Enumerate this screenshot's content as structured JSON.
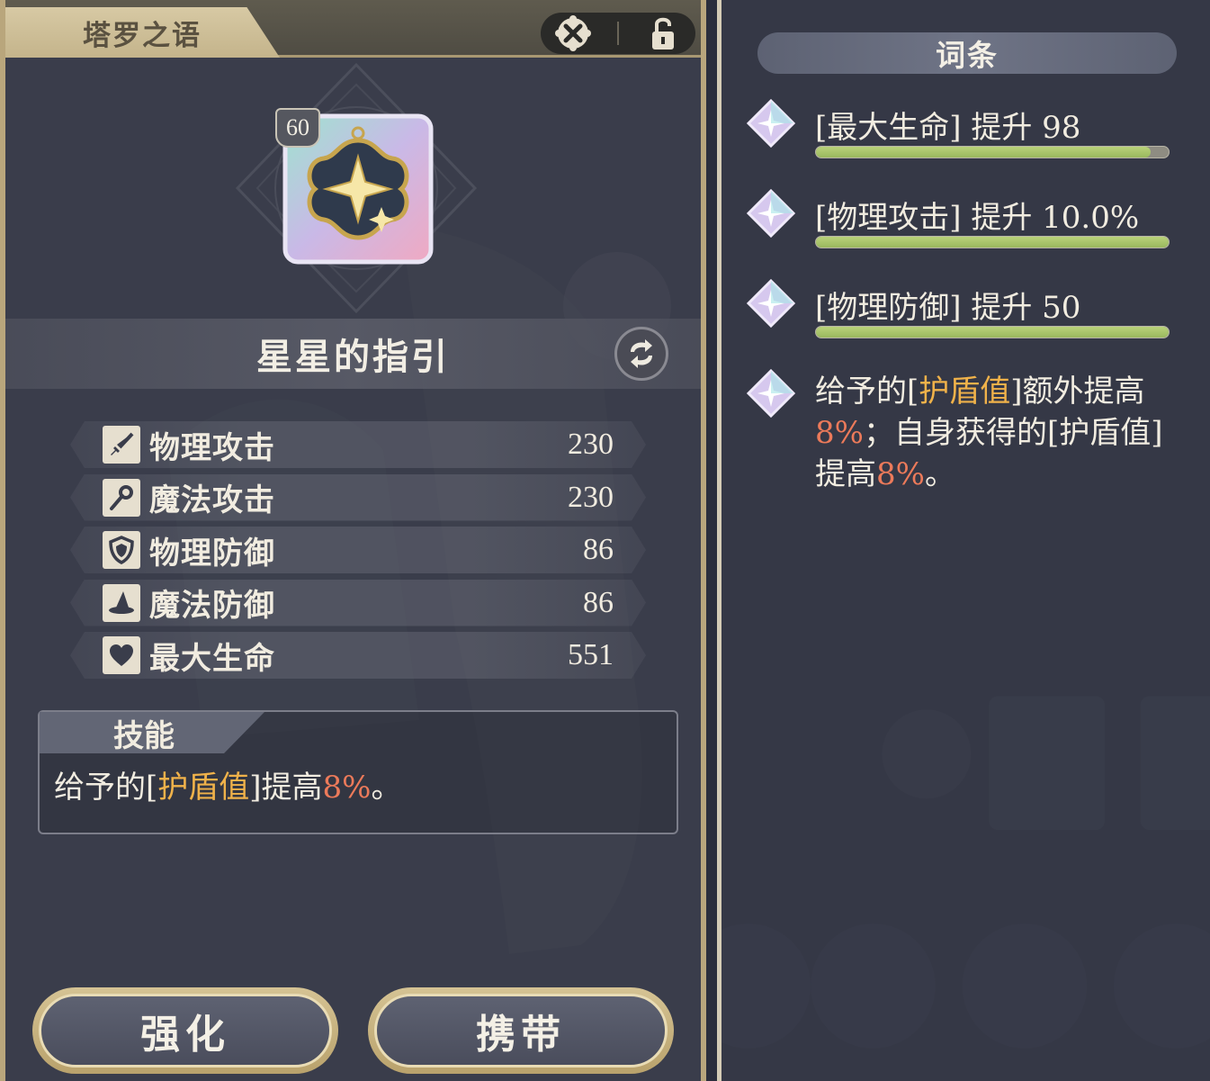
{
  "panel": {
    "title": "塔罗之语",
    "lock_icon": "unlock-icon",
    "discard_icon": "cross-icon"
  },
  "item": {
    "level": "60",
    "name": "星星的指引",
    "swap_icon": "swap-icon"
  },
  "stats": [
    {
      "label": "物理攻击",
      "value": "230",
      "icon": "sword-icon"
    },
    {
      "label": "魔法攻击",
      "value": "230",
      "icon": "staff-icon"
    },
    {
      "label": "物理防御",
      "value": "86",
      "icon": "shield-icon"
    },
    {
      "label": "魔法防御",
      "value": "86",
      "icon": "wizard-hat-icon"
    },
    {
      "label": "最大生命",
      "value": "551",
      "icon": "heart-icon"
    }
  ],
  "skill": {
    "tab": "技能",
    "text_prefix": "给予的[",
    "text_highlight": "护盾值",
    "text_mid": "]提高",
    "text_value": "8%",
    "text_suffix": "。"
  },
  "buttons": {
    "enhance": "强化",
    "equip": "携带"
  },
  "properties": {
    "header": "词条",
    "items": [
      {
        "text": "[最大生命] 提升 98",
        "fill": 0.95
      },
      {
        "text": "[物理攻击] 提升 10.0%",
        "fill": 1.0
      },
      {
        "text": "[物理防御] 提升 50",
        "fill": 1.0
      }
    ],
    "special": {
      "p1": "给予的[",
      "h1": "护盾值",
      "p2": "]额外提高",
      "v1": "8%",
      "p3": "；自身获得的[护盾值]提高",
      "v2": "8%",
      "p4": "。"
    }
  },
  "colors": {
    "highlight_yellow": "#f0b24a",
    "highlight_red": "#ec7a5a",
    "bar_green": "#a8c56a",
    "frame_gold": "#b9a67c"
  }
}
